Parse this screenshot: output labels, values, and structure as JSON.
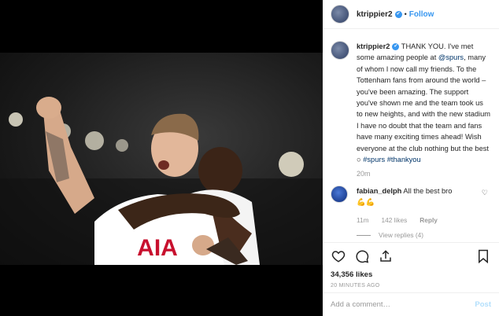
{
  "post": {
    "username": "ktrippier2",
    "follow_label": "Follow",
    "dot": "•",
    "verified_glyph": "✔"
  },
  "caption": {
    "username": "ktrippier2",
    "text_1": " THANK YOU. I've met some amazing people at ",
    "mention": "@spurs",
    "text_2": ", many of whom I now call my friends. To the Tottenham fans from around the world – you've been amazing. The support you've shown me and the team took us to new heights, and with the new stadium I have no doubt that the team and fans have many exciting times ahead! Wish everyone at the club nothing but the best ",
    "emoji": "○",
    "hashtag_1": "#spurs",
    "hashtag_2": "#thankyou",
    "time": "20m"
  },
  "comment": {
    "username": "fabian_delph",
    "text": "All the best bro",
    "emoji": "💪💪",
    "time": "11m",
    "likes": "142 likes",
    "reply": "Reply",
    "view_replies": "View replies (4)",
    "heart_icon": "heart-outline"
  },
  "actions": {
    "likes": "34,356 likes",
    "timestamp": "20 MINUTES AGO",
    "icons": [
      "heart-icon",
      "comment-icon",
      "share-icon",
      "bookmark-icon"
    ]
  },
  "add_comment": {
    "placeholder": "Add a comment…",
    "post_label": "Post"
  },
  "photo": {
    "shirt_text": "AIA"
  },
  "colors": {
    "accent": "#3897f0",
    "verified": "#3897f0",
    "link": "#003569",
    "post_disabled": "#b2dffc"
  }
}
